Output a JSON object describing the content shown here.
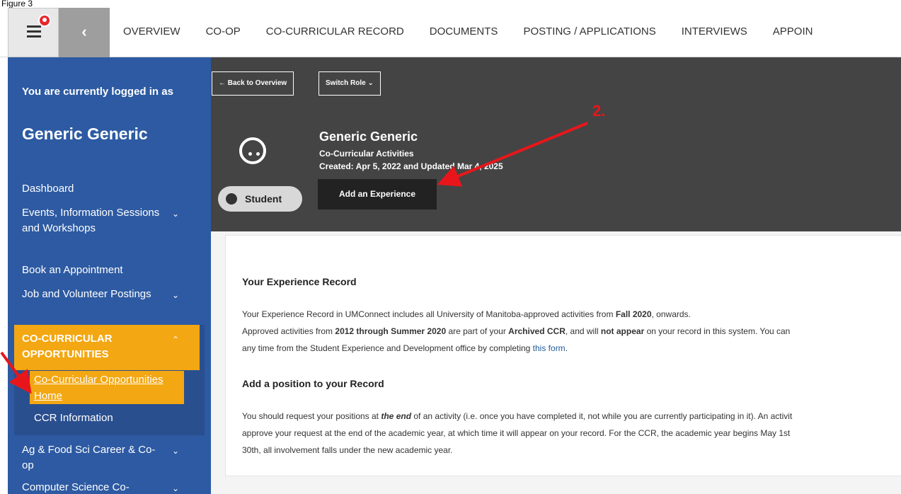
{
  "caption": "Figure 3",
  "topnav": {
    "tabs": [
      "OVERVIEW",
      "CO-OP",
      "CO-CURRICULAR RECORD",
      "DOCUMENTS",
      "POSTING / APPLICATIONS",
      "INTERVIEWS",
      "APPOIN"
    ],
    "collapse_glyph": "‹"
  },
  "sidebar": {
    "intro": "You are currently logged in as",
    "user_name": "Generic Generic",
    "items": {
      "dashboard": "Dashboard",
      "events": "Events, Information Sessions and Workshops",
      "appointment": "Book an Appointment",
      "jobs": "Job and Volunteer Postings",
      "ccr": "CO-CURRICULAR OPPORTUNITIES",
      "ccr_home": "Co-Curricular Opportunities Home",
      "ccr_info": "CCR Information",
      "agfood": "Ag & Food Sci Career & Co-op",
      "compsci": "Computer Science Co-"
    },
    "bg_color": "#2d5aa2",
    "highlight_color": "#f3a712"
  },
  "header": {
    "back_button": "← Back to Overview",
    "switch_role_button": "Switch Role ⌄",
    "name": "Generic Generic",
    "subtitle": "Co-Curricular Activities",
    "created": "Created: Apr 5, 2022 and Updated Mar 4, 2025",
    "role_badge": "Student",
    "add_experience_button": "Add an Experience",
    "annotation_number": "2."
  },
  "content": {
    "heading1": "Your Experience Record",
    "p1": "Your Experience Record in UMConnect includes all University of Manitoba-approved activities from ",
    "p1_bold": "Fall 2020",
    "p1_end": ", onwards.",
    "p2_a": "Approved activities from ",
    "p2_b": "2012 through Summer 2020",
    "p2_c": " are part of your ",
    "p2_d": "Archived CCR",
    "p2_e": ", and will ",
    "p2_f": "not appear",
    "p2_g": " on your record in this system. You can",
    "p3_a": "any time from the Student Experience and Development office by completing ",
    "p3_link": "this form",
    "p3_end": ".",
    "heading2": "Add a position to your Record",
    "p4_a": "You should request your positions at ",
    "p4_b": "the end",
    "p4_c": " of an activity (i.e. once you have completed it, not while you are currently participating in it). An activit",
    "p5": "approve your request at the end of the academic year, at which time it will appear on your record. For the CCR, the academic year begins May 1st",
    "p6": "30th, all involvement falls under the new academic year."
  }
}
